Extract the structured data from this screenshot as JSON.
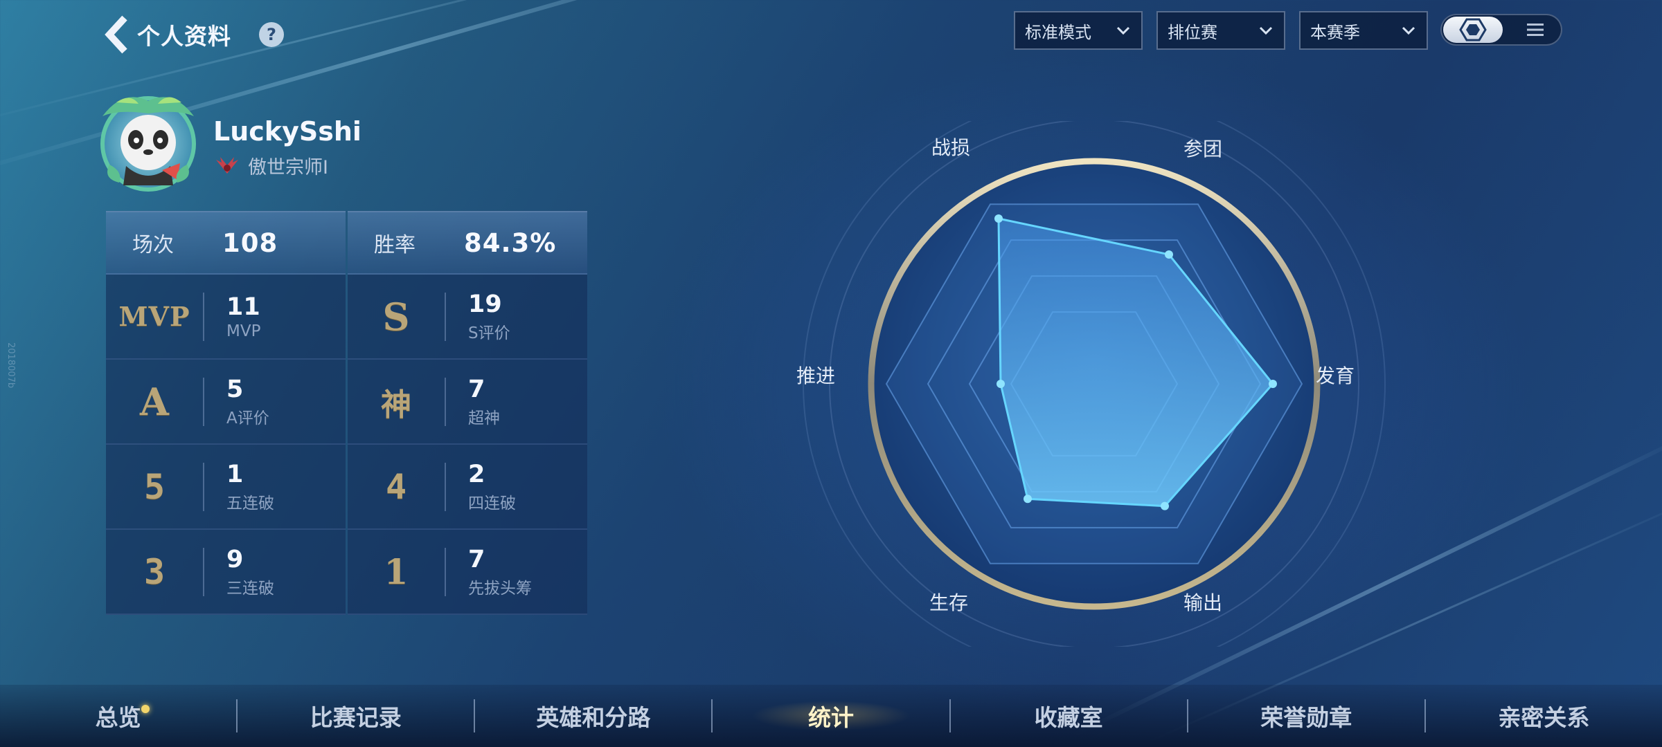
{
  "header": {
    "title": "个人资料",
    "help_icon": "?"
  },
  "filters": [
    {
      "value": "标准模式"
    },
    {
      "value": "排位赛"
    },
    {
      "value": "本赛季"
    }
  ],
  "profile": {
    "username": "LuckySshi",
    "rank": "傲世宗师I"
  },
  "stats": {
    "matches_label": "场次",
    "matches_value": "108",
    "winrate_label": "胜率",
    "winrate_value": "84.3%",
    "items": [
      {
        "badge": "MVP",
        "value": "11",
        "desc": "MVP"
      },
      {
        "badge": "S",
        "value": "19",
        "desc": "S评价"
      },
      {
        "badge": "A",
        "value": "5",
        "desc": "A评价"
      },
      {
        "badge": "神",
        "value": "7",
        "desc": "超神"
      },
      {
        "badge": "5",
        "value": "1",
        "desc": "五连破"
      },
      {
        "badge": "4",
        "value": "2",
        "desc": "四连破"
      },
      {
        "badge": "3",
        "value": "9",
        "desc": "三连破"
      },
      {
        "badge": "1",
        "value": "7",
        "desc": "先拔头筹"
      }
    ]
  },
  "radar": {
    "axes": [
      "战损",
      "参团",
      "发育",
      "输出",
      "生存",
      "推进"
    ],
    "values": [
      0.92,
      0.72,
      0.86,
      0.68,
      0.64,
      0.45
    ]
  },
  "nav": {
    "tabs": [
      "总览",
      "比赛记录",
      "英雄和分路",
      "统计",
      "收藏室",
      "荣誉勋章",
      "亲密关系"
    ],
    "active_index": 3
  },
  "watermark": "2018007b",
  "colors": {
    "accent": "#4fd0ff",
    "gold": "#c9b47f"
  }
}
